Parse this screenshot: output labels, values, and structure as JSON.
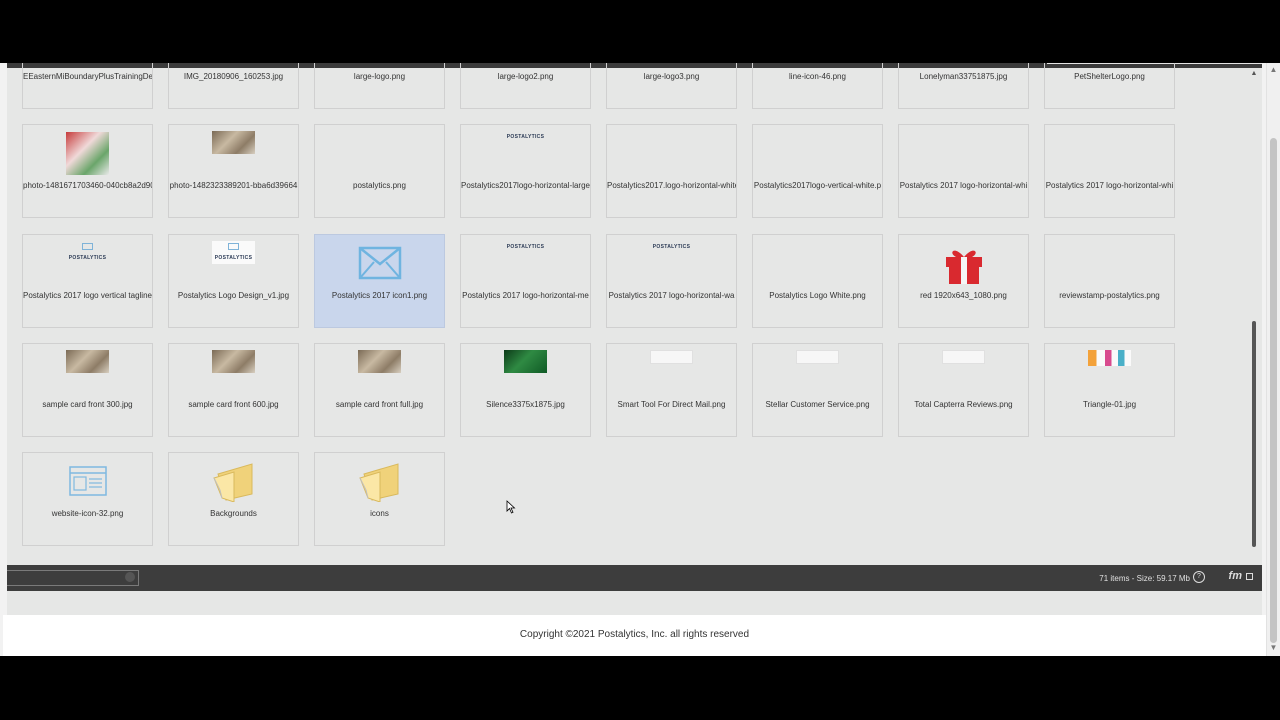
{
  "files_row1": [
    "EEasternMiBoundaryPlusTrainingDe",
    "IMG_20180906_160253.jpg",
    "large-logo.png",
    "large-logo2.png",
    "large-logo3.png",
    "line-icon-46.png",
    "Lonelyman33751875.jpg",
    "PetShelterLogo.png"
  ],
  "files_row2": [
    "photo-1481671703460-040cb8a2d90",
    "photo-1482323389201-bba6d39664",
    "postalytics.png",
    "Postalytics2017logo-horizontal-large",
    "Postalytics2017.logo-horizontal-white",
    "Postalytics2017logo-vertical-white.p",
    "Postalytics 2017 logo-horizontal-whi",
    "Postalytics 2017 logo-horizontal-whi"
  ],
  "files_row3": [
    "Postalytics 2017 logo vertical tagline",
    "Postalytics Logo Design_v1.jpg",
    "Postalytics 2017 icon1.png",
    "Postalytics 2017 logo-horizontal-me",
    "Postalytics 2017 logo-horizontal-wa",
    "Postalytics Logo White.png",
    "red 1920x643_1080.png",
    "reviewstamp-postalytics.png"
  ],
  "files_row4": [
    "sample card front 300.jpg",
    "sample card front 600.jpg",
    "sample card front full.jpg",
    "Silence3375x1875.jpg",
    "Smart Tool For Direct Mail.png",
    "Stellar Customer Service.png",
    "Total Capterra Reviews.png",
    "Triangle-01.jpg"
  ],
  "files_row5": [
    "website-icon-32.png",
    "Backgrounds",
    "icons"
  ],
  "thumb_brand_text": "POSTALYTICS",
  "status": {
    "info": "71 items - Size: 59.17 Mb",
    "help": "?",
    "brand": "fm"
  },
  "footer": {
    "copyright": "Copyright ©2021 Postalytics, Inc. all rights reserved"
  },
  "colors": {
    "selected_tile": "#c9d6ec",
    "accent_gift": "#d9292f",
    "folder": "#f0d27a"
  }
}
